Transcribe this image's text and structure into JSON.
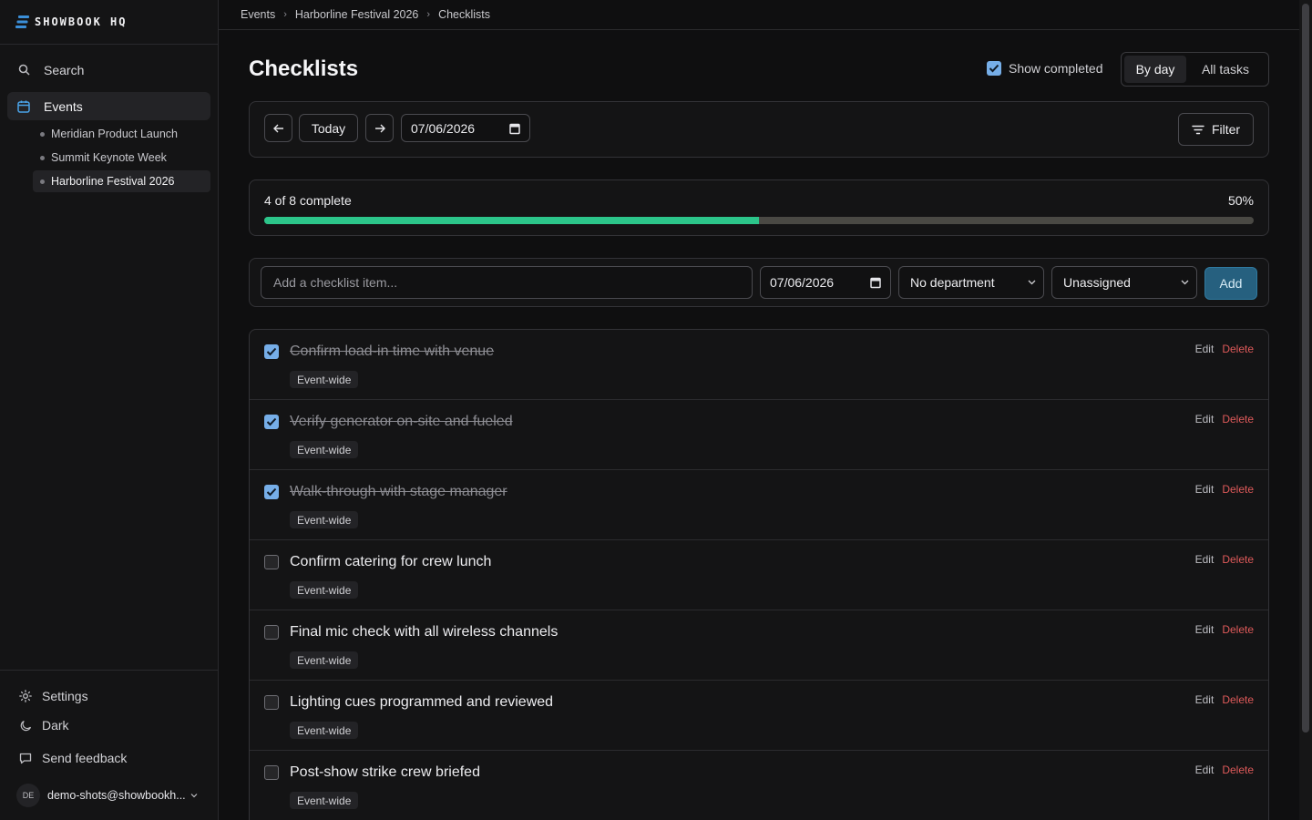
{
  "app": {
    "brand": "SHOWBOOK HQ",
    "accent": "#2cc58a"
  },
  "sidebar": {
    "search_label": "Search",
    "events_label": "Events",
    "events": [
      {
        "label": "Meridian Product Launch"
      },
      {
        "label": "Summit Keynote Week"
      },
      {
        "label": "Harborline Festival 2026"
      }
    ],
    "settings_label": "Settings",
    "theme_label": "Dark",
    "feedback_label": "Send feedback",
    "user": {
      "initials": "DE",
      "email": "demo-shots@showbookh..."
    }
  },
  "breadcrumb": [
    "Events",
    "Harborline Festival 2026",
    "Checklists"
  ],
  "page": {
    "title": "Checklists",
    "show_completed_label": "Show completed",
    "show_completed": true,
    "view_tabs": [
      "By day",
      "All tasks"
    ],
    "active_view": "By day"
  },
  "toolbar": {
    "today_label": "Today",
    "date_value": "07/06/2026",
    "filter_label": "Filter"
  },
  "progress": {
    "label": "4 of 8 complete",
    "percent_label": "50%",
    "fraction": 0.5
  },
  "add_form": {
    "placeholder": "Add a checklist item...",
    "date_value": "07/06/2026",
    "department": "No department",
    "assignee": "Unassigned",
    "add_label": "Add"
  },
  "actions": {
    "edit": "Edit",
    "delete": "Delete"
  },
  "items": [
    {
      "title": "Confirm load-in time with venue",
      "tag": "Event-wide",
      "done": true
    },
    {
      "title": "Verify generator on-site and fueled",
      "tag": "Event-wide",
      "done": true
    },
    {
      "title": "Walk-through with stage manager",
      "tag": "Event-wide",
      "done": true
    },
    {
      "title": "Confirm catering for crew lunch",
      "tag": "Event-wide",
      "done": false
    },
    {
      "title": "Final mic check with all wireless channels",
      "tag": "Event-wide",
      "done": false
    },
    {
      "title": "Lighting cues programmed and reviewed",
      "tag": "Event-wide",
      "done": false
    },
    {
      "title": "Post-show strike crew briefed",
      "tag": "Event-wide",
      "done": false
    }
  ]
}
